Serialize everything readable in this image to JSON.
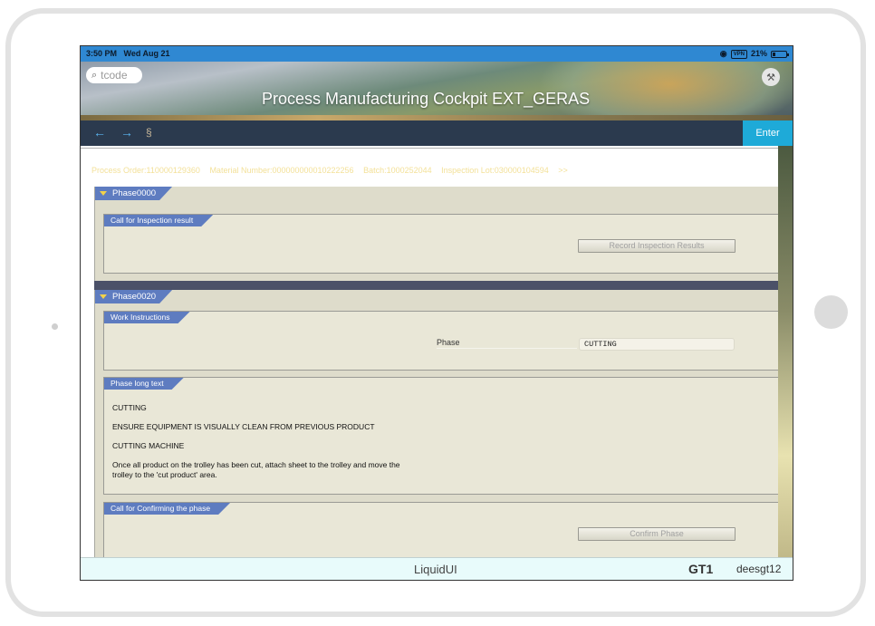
{
  "status_bar": {
    "time": "3:50 PM",
    "date": "Wed Aug 21",
    "wifi_icon": "wifi-icon",
    "vpn": "VPN",
    "battery": "21%"
  },
  "header": {
    "search_placeholder": "tcode",
    "title": "Process Manufacturing Cockpit EXT_GERAS",
    "tool_icon": "wrench-icon"
  },
  "toolbar": {
    "back_icon": "←",
    "forward_icon": "→",
    "scroll_icon": "§",
    "enter_label": "Enter"
  },
  "info": {
    "process_order": "Process Order:110000129360",
    "material_number": "Material Number:000000000010222256",
    "batch": "Batch:1000252044",
    "inspection_lot": "Inspection Lot:030000104594",
    "more": ">>"
  },
  "phases": [
    {
      "label": "Phase0000",
      "groups": [
        {
          "label": "Call for Inspection result",
          "button": "Record Inspection Results"
        }
      ]
    },
    {
      "label": "Phase0020",
      "groups": [
        {
          "label": "Work Instructions",
          "field_label": "Phase",
          "field_value": "CUTTING"
        },
        {
          "label": "Phase long text",
          "lines": [
            "CUTTING",
            "ENSURE EQUIPMENT IS VISUALLY CLEAN FROM PREVIOUS PRODUCT",
            "CUTTING MACHINE",
            "Once all product on the trolley has been cut, attach sheet to the trolley and move the",
            "trolley to the 'cut product' area."
          ]
        },
        {
          "label": "Call for Confirming the phase",
          "button": "Confirm Phase"
        }
      ]
    }
  ],
  "footer": {
    "brand": "LiquidUI",
    "system": "GT1",
    "user": "deesgt12"
  },
  "colors": {
    "status_bar": "#2f88d2",
    "toolbar": "#2b3a4e",
    "enter_button": "#1eaad8",
    "tab_blue": "#5e7cc0",
    "info_text": "#f3e19a",
    "separator": "#4b5168"
  }
}
